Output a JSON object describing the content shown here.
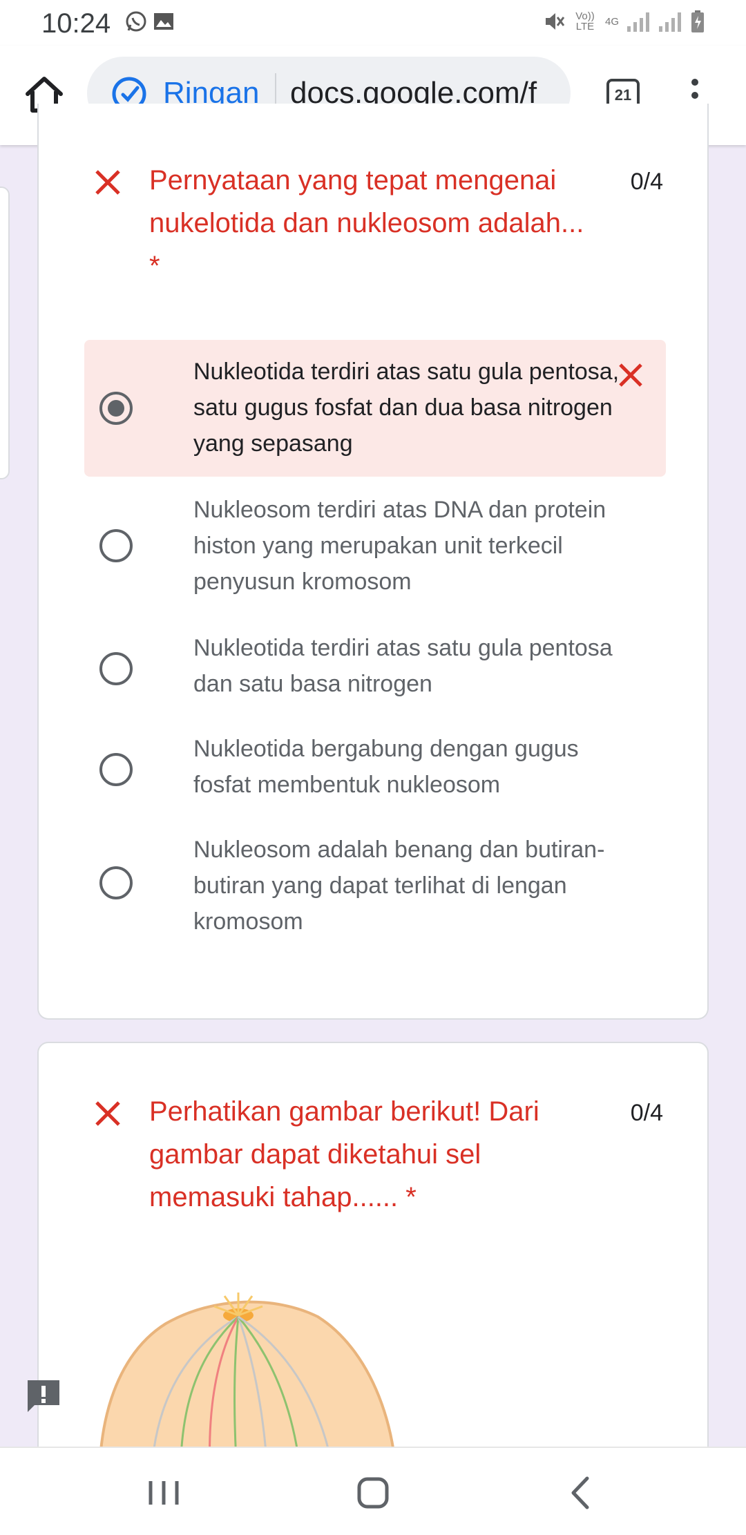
{
  "status_bar": {
    "time": "10:24",
    "volte_label": "Vo)) LTE",
    "network_label": "4G"
  },
  "browser": {
    "lite_mode_label": "Ringan",
    "url": "docs.google.com/f",
    "tab_count": "21"
  },
  "questions": [
    {
      "title": "Pernyataan yang tepat mengenai nukelotida dan nukleosom adalah...",
      "required_mark": "*",
      "score": "0/4",
      "options": [
        {
          "text": "Nukleotida terdiri atas satu gula pentosa, satu gugus fosfat dan dua basa nitrogen yang sepasang",
          "selected": true,
          "status": "incorrect"
        },
        {
          "text": "Nukleosom terdiri atas DNA dan protein histon yang merupakan unit terkecil penyusun kromosom",
          "selected": false
        },
        {
          "text": "Nukleotida terdiri atas satu gula pentosa dan satu basa nitrogen",
          "selected": false
        },
        {
          "text": "Nukleotida bergabung dengan gugus fosfat membentuk nukleosom",
          "selected": false
        },
        {
          "text": "Nukleosom adalah benang dan butiran-butiran yang dapat terlihat di lengan kromosom",
          "selected": false
        }
      ]
    },
    {
      "title": "Perhatikan gambar berikut! Dari gambar dapat diketahui sel memasuki tahap...... *",
      "score": "0/4"
    }
  ],
  "colors": {
    "error_red": "#d93025",
    "incorrect_bg": "#fce8e6",
    "page_bg": "#efeaf7",
    "link_blue": "#1a73e8"
  },
  "icons": {
    "home": "home-icon",
    "lite_mode": "lite-mode-gauge-icon",
    "menu": "more-vert-icon",
    "incorrect": "close-icon",
    "feedback": "report-icon",
    "nav_recents": "recents-icon",
    "nav_home": "nav-home-icon",
    "nav_back": "back-icon"
  }
}
